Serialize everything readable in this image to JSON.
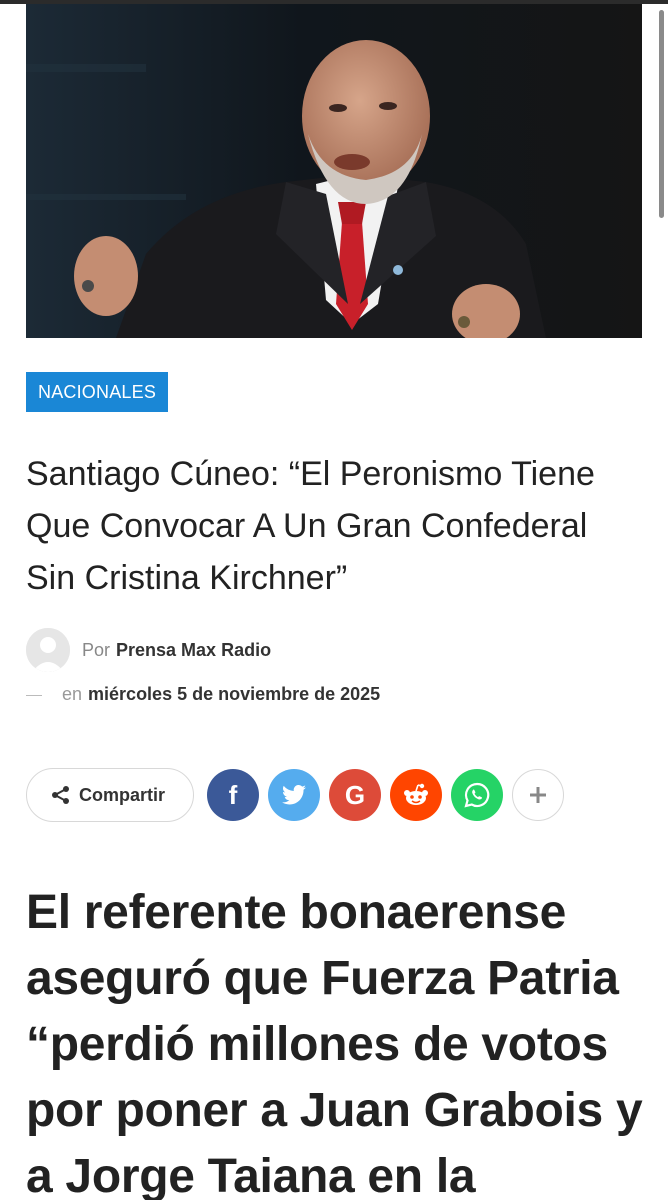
{
  "article": {
    "category": "NACIONALES",
    "title": "Santiago Cúneo: “El Peronismo Tiene Que Convocar A Un Gran Confederal Sin Cristina Kirchner”",
    "author_prefix": "Por",
    "author": "Prensa Max Radio",
    "date_prefix": "en",
    "date": "miércoles 5 de noviembre de 2025",
    "lead": "El referente bonaerense aseguró que Fuerza Patria “perdió millones de votos por poner a Juan Grabois y a Jorge Taiana en la"
  },
  "share": {
    "label": "Compartir",
    "buttons": [
      {
        "name": "facebook",
        "icon": "facebook-icon",
        "color": "#3b5998"
      },
      {
        "name": "twitter",
        "icon": "twitter-icon",
        "color": "#55acee"
      },
      {
        "name": "google",
        "icon": "google-icon",
        "color": "#dd4b39"
      },
      {
        "name": "reddit",
        "icon": "reddit-icon",
        "color": "#ff4500"
      },
      {
        "name": "whatsapp",
        "icon": "whatsapp-icon",
        "color": "#25d366"
      },
      {
        "name": "more",
        "icon": "plus-icon",
        "color": "#ffffff"
      }
    ]
  },
  "colors": {
    "accent": "#1a87d6",
    "text": "#222222"
  }
}
